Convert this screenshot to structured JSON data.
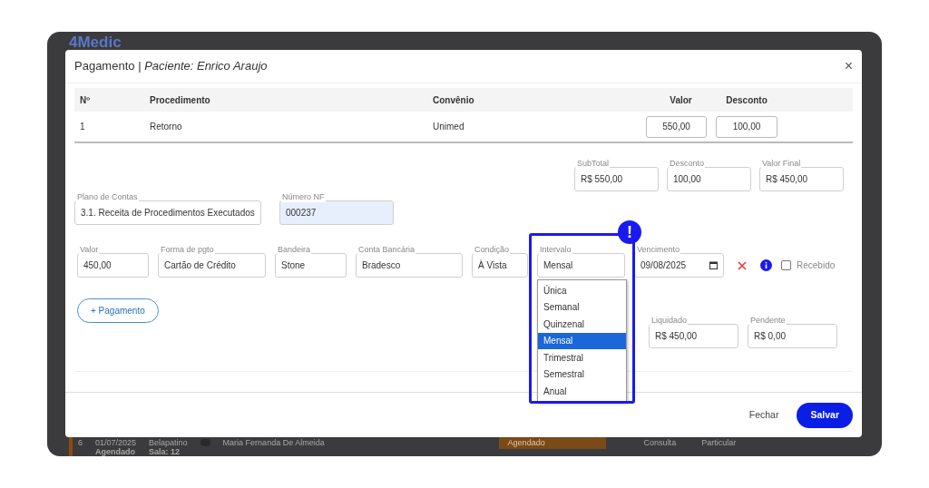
{
  "background_app": {
    "logo": "4Medic",
    "row": {
      "number": "6",
      "date": "01/07/2025",
      "status": "Agendado",
      "professional": "Belapatino",
      "room": "Sala: 12",
      "patient": "Maria Fernanda De Almeida",
      "status_select": "Agendado",
      "type": "Consulta",
      "plan": "Particular"
    }
  },
  "modal": {
    "title": "Pagamento",
    "separator": "|",
    "subtitle": "Paciente: Enrico Araujo",
    "close_mark": "×",
    "table": {
      "columns": [
        "Nº",
        "Procedimento",
        "Convênio",
        "Valor",
        "Desconto"
      ],
      "rows": [
        {
          "number": "1",
          "procedure": "Retorno",
          "insurance": "Unimed",
          "value": "550,00",
          "discount": "100,00"
        }
      ]
    },
    "totals": [
      {
        "label": "SubTotal",
        "value": "R$ 550,00"
      },
      {
        "label": "Desconto",
        "value": "100,00"
      },
      {
        "label": "Valor Final",
        "value": "R$ 450,00"
      }
    ],
    "account_fields": [
      {
        "label": "Plano de Contas",
        "value": "3.1. Receita de Procedimentos Executados",
        "highlighted": false
      },
      {
        "label": "Número NF",
        "value": "000237",
        "highlighted": true
      }
    ],
    "payment": {
      "fields": [
        {
          "label": "Valor",
          "value": "450,00"
        },
        {
          "label": "Forma de pgto",
          "value": "Cartão de Crédito"
        },
        {
          "label": "Bandeira",
          "value": "Stone"
        },
        {
          "label": "Conta Bancária",
          "value": "Bradesco"
        },
        {
          "label": "Condição",
          "value": "À Vista"
        }
      ],
      "interval": {
        "label": "Intervalo",
        "value": "Mensal",
        "expanded": true,
        "options": [
          {
            "label": "Única",
            "selected": false
          },
          {
            "label": "Semanal",
            "selected": false
          },
          {
            "label": "Quinzenal",
            "selected": false
          },
          {
            "label": "Mensal",
            "selected": true
          },
          {
            "label": "Trimestral",
            "selected": false
          },
          {
            "label": "Semestral",
            "selected": false
          },
          {
            "label": "Anual",
            "selected": false
          }
        ]
      },
      "due_date": {
        "label": "Vencimento",
        "value": "09/08/2025"
      },
      "received": {
        "label": "Recebido",
        "checked": false
      }
    },
    "add_payment": "+ Pagamento",
    "balances": [
      {
        "label": "Liquidado",
        "value": "R$ 450,00"
      },
      {
        "label": "Pendente",
        "value": "R$ 0,00"
      }
    ],
    "buttons": {
      "close": "Fechar",
      "save": "Salvar"
    }
  },
  "callout": {
    "mark": "!"
  }
}
